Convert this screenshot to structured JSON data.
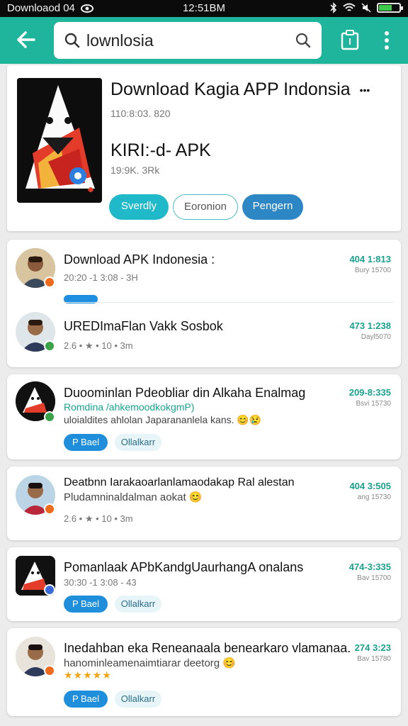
{
  "status_bar": {
    "left_text": "Downloaod 04",
    "time": "12:51BM",
    "icons": [
      "eye-icon",
      "bluetooth-icon",
      "wifi-icon",
      "mute-icon",
      "battery-icon"
    ]
  },
  "toolbar": {
    "search_value": "lownlosia",
    "back_icon": "arrow-left-icon",
    "search_icon": "magnifier-icon",
    "copy_icon": "clipboard-icon",
    "more_icon": "more-vertical-icon",
    "color": "#1fb59d"
  },
  "app_card": {
    "title": "Download Kagia APP Indonsia",
    "title_more": "•••",
    "meta1": "110:8:03. 820",
    "app_name": "KIRI:-d- APK",
    "meta2": "19:9K. 3Rk",
    "buttons": [
      "Sverdly",
      "Eoronion",
      "Pengern"
    ]
  },
  "results": [
    {
      "rows": [
        {
          "title": "Download APK Indonesia :",
          "meta": "20:20 -1 3:08 - 3H",
          "date": "404 1:813",
          "size": "Bury 15700",
          "avatar_icon": "person-avatar-icon"
        },
        {
          "title": "UREDImaFlan Vakk Sosbok",
          "meta": "2.6 • ★ • 10 • 3m",
          "date": "473 1:238",
          "size": "Dayl5070",
          "avatar_icon": "person-avatar-icon"
        }
      ]
    },
    {
      "title": "Duoominlan Pdeobliar din Alkaha Enalmag",
      "sub": "Romdina /ahkemoodkokgmP)",
      "sub2": "uloialdites ahlolan Japarananlela kans. 😊😢",
      "date": "209-8:335",
      "size": "Bsvi 15730",
      "btn1": "P Bael",
      "btn2": "Ollalkarr",
      "avatar_icon": "shark-logo-icon"
    },
    {
      "title": "Deatbnn Iarakaoarlanlamaodakap Ral alestan",
      "sub": "Pludamninaldalman aokat 😊",
      "meta": "2.6 • ★ • 10 • 3m",
      "date": "404 3:505",
      "size": "ang 15730",
      "avatar_icon": "person-avatar-icon"
    },
    {
      "title": "Pomanlaak APbKandgUaurhangA onalans",
      "meta": "30:30 -1 3:08 - 43",
      "date": "474-3:335",
      "size": "Bav 15700",
      "btn1": "P Bael",
      "btn2": "Ollalkarr",
      "avatar_icon": "shark-logo-icon"
    },
    {
      "title": "Inedahban eka Reneanaala benearkaro vlamanaa.",
      "sub": "hanominleamenaimtiarar deetorg 😊",
      "stars": "★★★★★",
      "date": "274 3:23",
      "size": "Bav 15780",
      "btn1": "P Bael",
      "btn2": "Ollalkarr",
      "avatar_icon": "person-avatar-icon"
    }
  ]
}
